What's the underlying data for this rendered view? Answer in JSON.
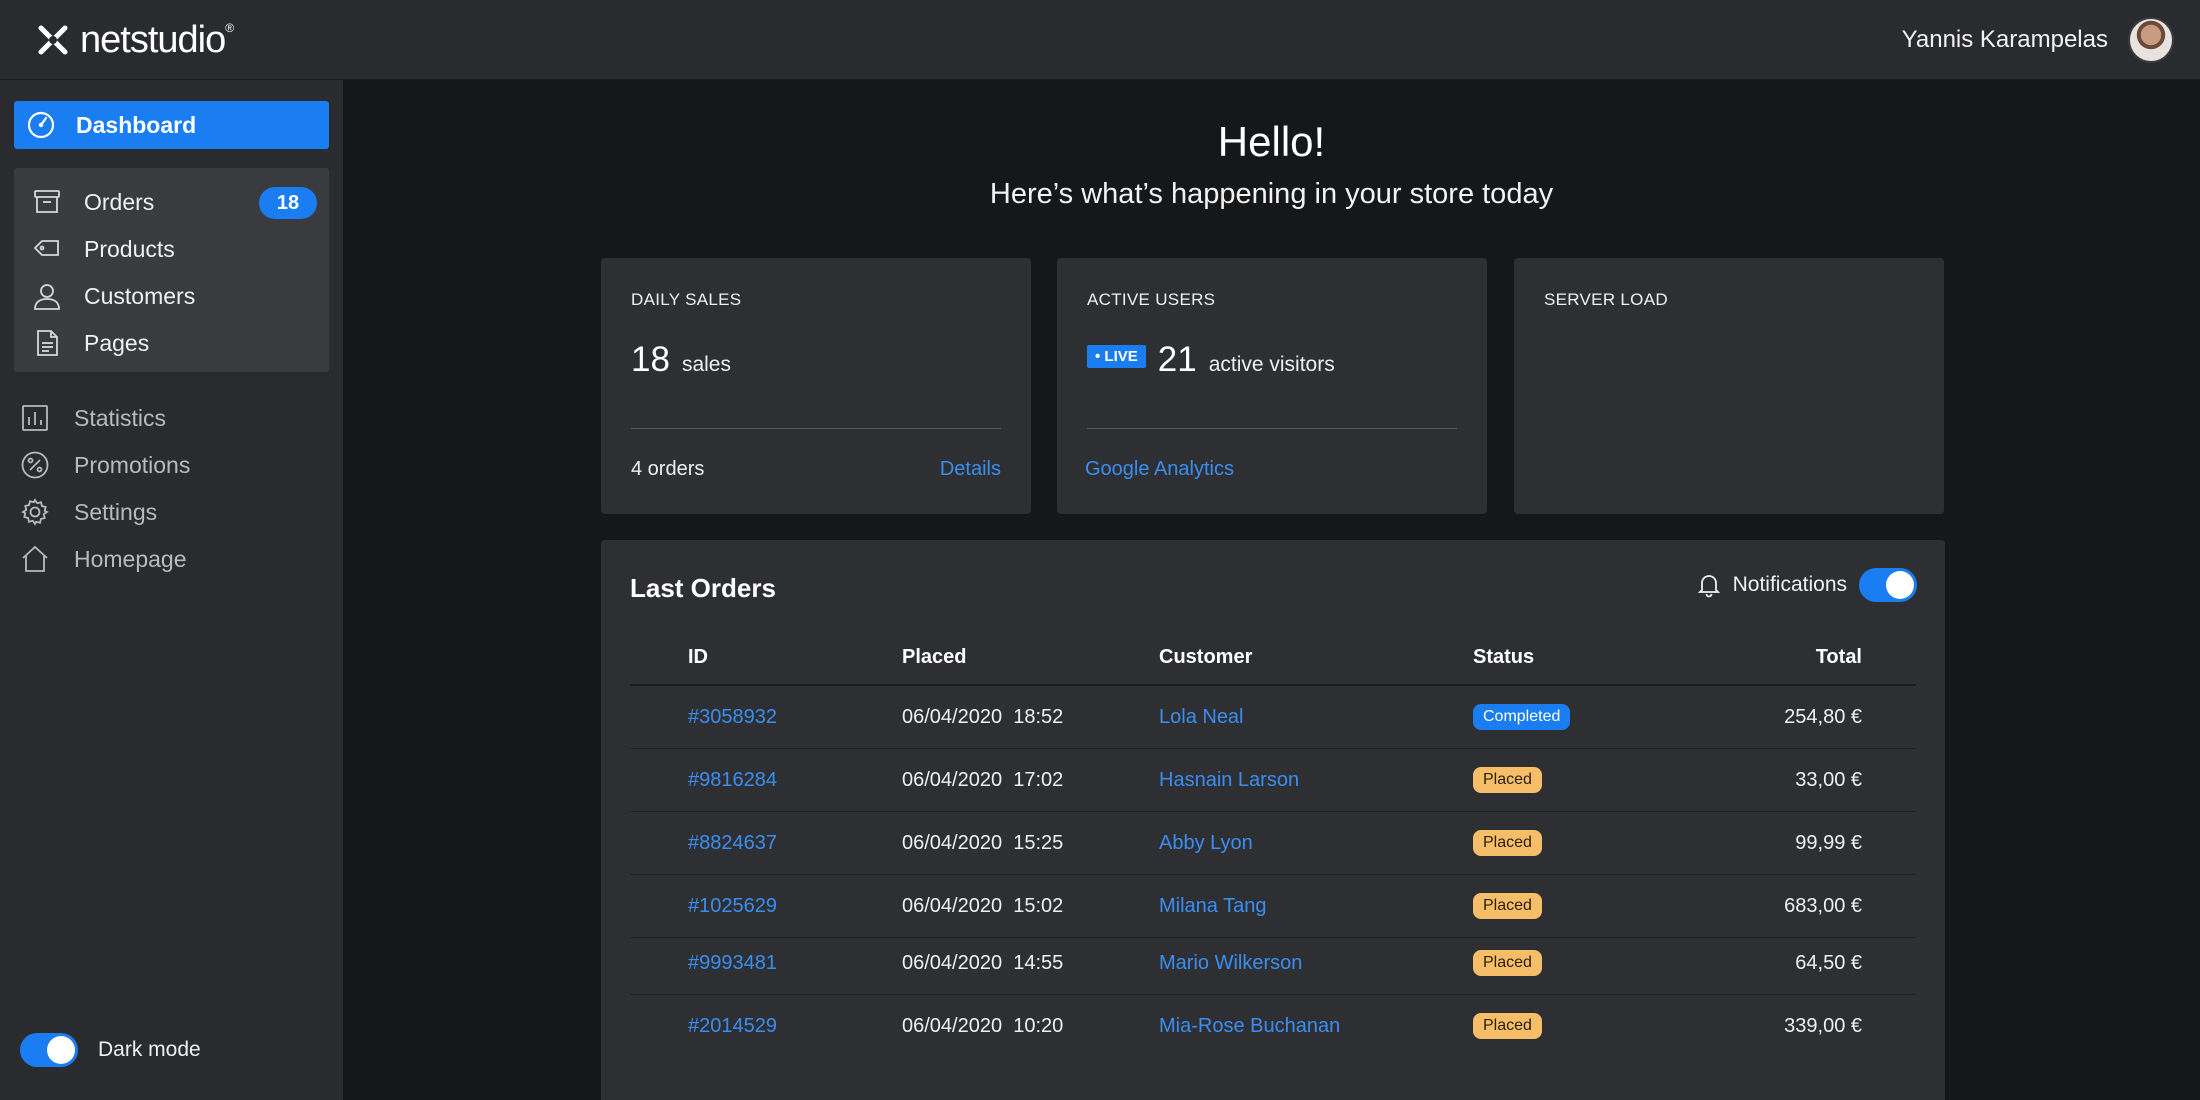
{
  "app": {
    "brand": "netstudio",
    "registered_mark": "®",
    "user_name": "Yannis Karampelas"
  },
  "sidebar": {
    "dashboard": {
      "label": "Dashboard",
      "icon": "gauge-icon"
    },
    "group": [
      {
        "label": "Orders",
        "icon": "archive-box-icon",
        "badge": "18"
      },
      {
        "label": "Products",
        "icon": "tag-icon"
      },
      {
        "label": "Customers",
        "icon": "user-icon"
      },
      {
        "label": "Pages",
        "icon": "document-icon"
      }
    ],
    "items": [
      {
        "label": "Statistics",
        "icon": "bar-chart-icon"
      },
      {
        "label": "Promotions",
        "icon": "percent-icon"
      },
      {
        "label": "Settings",
        "icon": "gear-icon"
      },
      {
        "label": "Homepage",
        "icon": "home-icon"
      }
    ],
    "dark_mode": {
      "label": "Dark mode",
      "on": true
    }
  },
  "main": {
    "greeting": "Hello!",
    "subtitle": "Here’s what’s happening in your store today",
    "cards": {
      "daily_sales": {
        "title": "DAILY SALES",
        "value": "18",
        "unit": "sales",
        "footer": "4 orders",
        "link": "Details"
      },
      "active_users": {
        "title": "ACTIVE USERS",
        "live_label": "• LIVE",
        "value": "21",
        "unit": "active visitors",
        "link": "Google Analytics"
      },
      "server_load": {
        "title": "SERVER LOAD"
      }
    },
    "orders": {
      "title": "Last Orders",
      "notifications_label": "Notifications",
      "notifications_on": true,
      "columns": [
        "ID",
        "Placed",
        "Customer",
        "Status",
        "Total"
      ],
      "rows": [
        {
          "id": "#3058932",
          "placed": "06/04/2020  18:52",
          "customer": "Lola Neal",
          "status": "Completed",
          "total": "254,80 €"
        },
        {
          "id": "#9816284",
          "placed": "06/04/2020  17:02",
          "customer": "Hasnain Larson",
          "status": "Placed",
          "total": "33,00 €"
        },
        {
          "id": "#8824637",
          "placed": "06/04/2020  15:25",
          "customer": "Abby Lyon",
          "status": "Placed",
          "total": "99,99 €"
        },
        {
          "id": "#1025629",
          "placed": "06/04/2020  15:02",
          "customer": "Milana Tang",
          "status": "Placed",
          "total": "683,00 €"
        },
        {
          "id": "#9993481",
          "placed": "06/04/2020  14:55",
          "customer": "Mario Wilkerson",
          "status": "Placed",
          "total": "64,50 €"
        },
        {
          "id": "#2014529",
          "placed": "06/04/2020  10:20",
          "customer": "Mia-Rose Buchanan",
          "status": "Placed",
          "total": "339,00 €"
        }
      ]
    }
  },
  "colors": {
    "accent": "#1a7ef2",
    "link": "#3a8ef0",
    "placed_pill": "#f7be6a",
    "panel": "#2e2f33",
    "background": "#161719"
  }
}
